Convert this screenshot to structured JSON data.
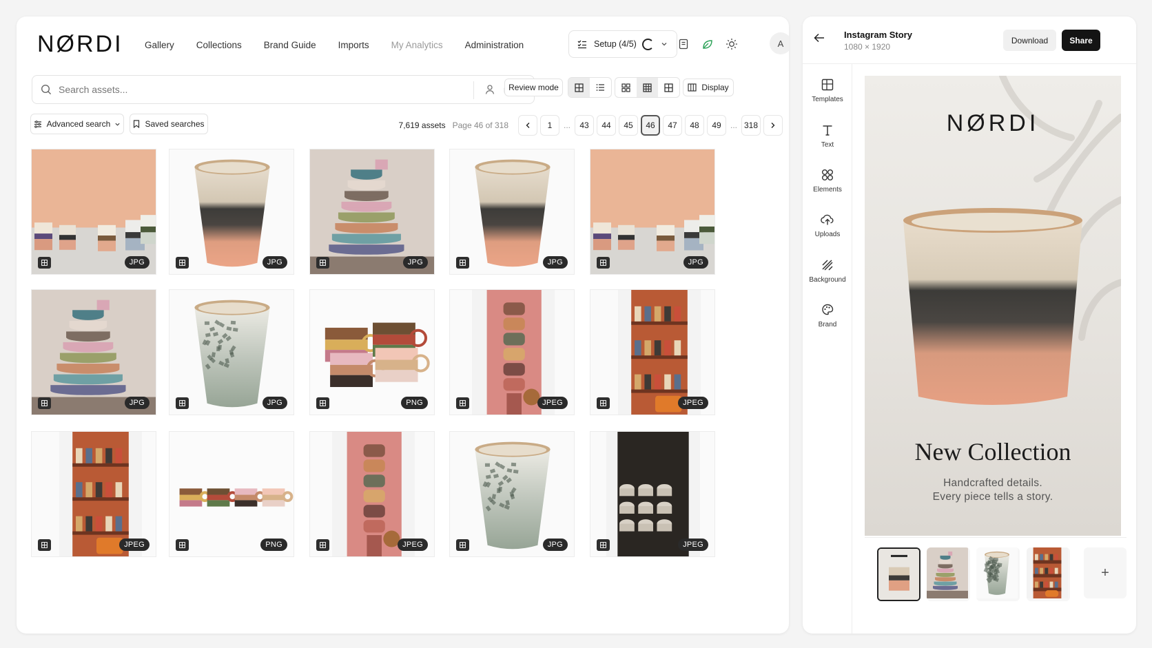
{
  "brand": {
    "logo": "NØRDI"
  },
  "nav": {
    "items": [
      {
        "label": "Gallery",
        "muted": false
      },
      {
        "label": "Collections",
        "muted": false
      },
      {
        "label": "Brand Guide",
        "muted": false
      },
      {
        "label": "Imports",
        "muted": false
      },
      {
        "label": "My Analytics",
        "muted": true
      },
      {
        "label": "Administration",
        "muted": false
      }
    ],
    "setup_label": "Setup (4/5)",
    "avatar_initial": "A"
  },
  "search": {
    "placeholder": "Search assets...",
    "review_mode_label": "Review mode",
    "display_label": "Display"
  },
  "filters": {
    "advanced_label": "Advanced search",
    "saved_label": "Saved searches"
  },
  "pagination": {
    "count": "7,619 assets",
    "page_info": "Page 46 of 318",
    "pages": [
      "1",
      "...",
      "43",
      "44",
      "45",
      "46",
      "47",
      "48",
      "49",
      "...",
      "318"
    ],
    "current": "46"
  },
  "assets": [
    {
      "format": "JPG",
      "scene": "cups-peach"
    },
    {
      "format": "JPG",
      "scene": "cup-peach"
    },
    {
      "format": "JPG",
      "scene": "stack"
    },
    {
      "format": "JPG",
      "scene": "cup-peach"
    },
    {
      "format": "JPG",
      "scene": "cups-peach"
    },
    {
      "format": "JPG",
      "scene": "stack"
    },
    {
      "format": "JPG",
      "scene": "cup-green"
    },
    {
      "format": "PNG",
      "scene": "mugs"
    },
    {
      "format": "JPEG",
      "scene": "pink-stack"
    },
    {
      "format": "JPEG",
      "scene": "shelf"
    },
    {
      "format": "JPEG",
      "scene": "shelf"
    },
    {
      "format": "PNG",
      "scene": "mugs-row"
    },
    {
      "format": "JPEG",
      "scene": "pink-stack"
    },
    {
      "format": "JPG",
      "scene": "cup-green"
    },
    {
      "format": "JPEG",
      "scene": "dark"
    }
  ],
  "editor": {
    "title": "Instagram Story",
    "size": "1080 × 1920",
    "download_label": "Download",
    "share_label": "Share",
    "tools": [
      {
        "label": "Templates",
        "icon": "templates-icon"
      },
      {
        "label": "Text",
        "icon": "text-icon"
      },
      {
        "label": "Elements",
        "icon": "elements-icon"
      },
      {
        "label": "Uploads",
        "icon": "upload-icon"
      },
      {
        "label": "Background",
        "icon": "background-icon"
      },
      {
        "label": "Brand",
        "icon": "brand-icon"
      }
    ],
    "canvas": {
      "logo": "NØRDI",
      "headline": "New Collection",
      "sub1": "Handcrafted details.",
      "sub2": "Every piece tells a story."
    },
    "thumbnails": [
      {
        "scene": "story",
        "selected": true
      },
      {
        "scene": "stack",
        "selected": false
      },
      {
        "scene": "cup-green",
        "selected": false
      },
      {
        "scene": "shelf",
        "selected": false
      }
    ]
  }
}
